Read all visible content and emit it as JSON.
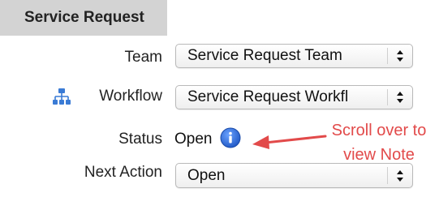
{
  "header": {
    "title": "Service Request"
  },
  "fields": {
    "team": {
      "label": "Team",
      "value": "Service Request Team"
    },
    "workflow": {
      "label": "Workflow",
      "value": "Service Request Workfl",
      "icon": "workflow-hierarchy-icon"
    },
    "status": {
      "label": "Status",
      "value": "Open",
      "icon": "info-icon"
    },
    "next_action": {
      "label": "Next Action",
      "value": "Open"
    }
  },
  "annotation": {
    "line1": "Scroll over to",
    "line2": "view Note",
    "color": "#e24a4a"
  },
  "colors": {
    "header_bg": "#d3d3d3",
    "info_blue": "#2f6fdd",
    "workflow_icon_blue": "#3a7bd5"
  }
}
